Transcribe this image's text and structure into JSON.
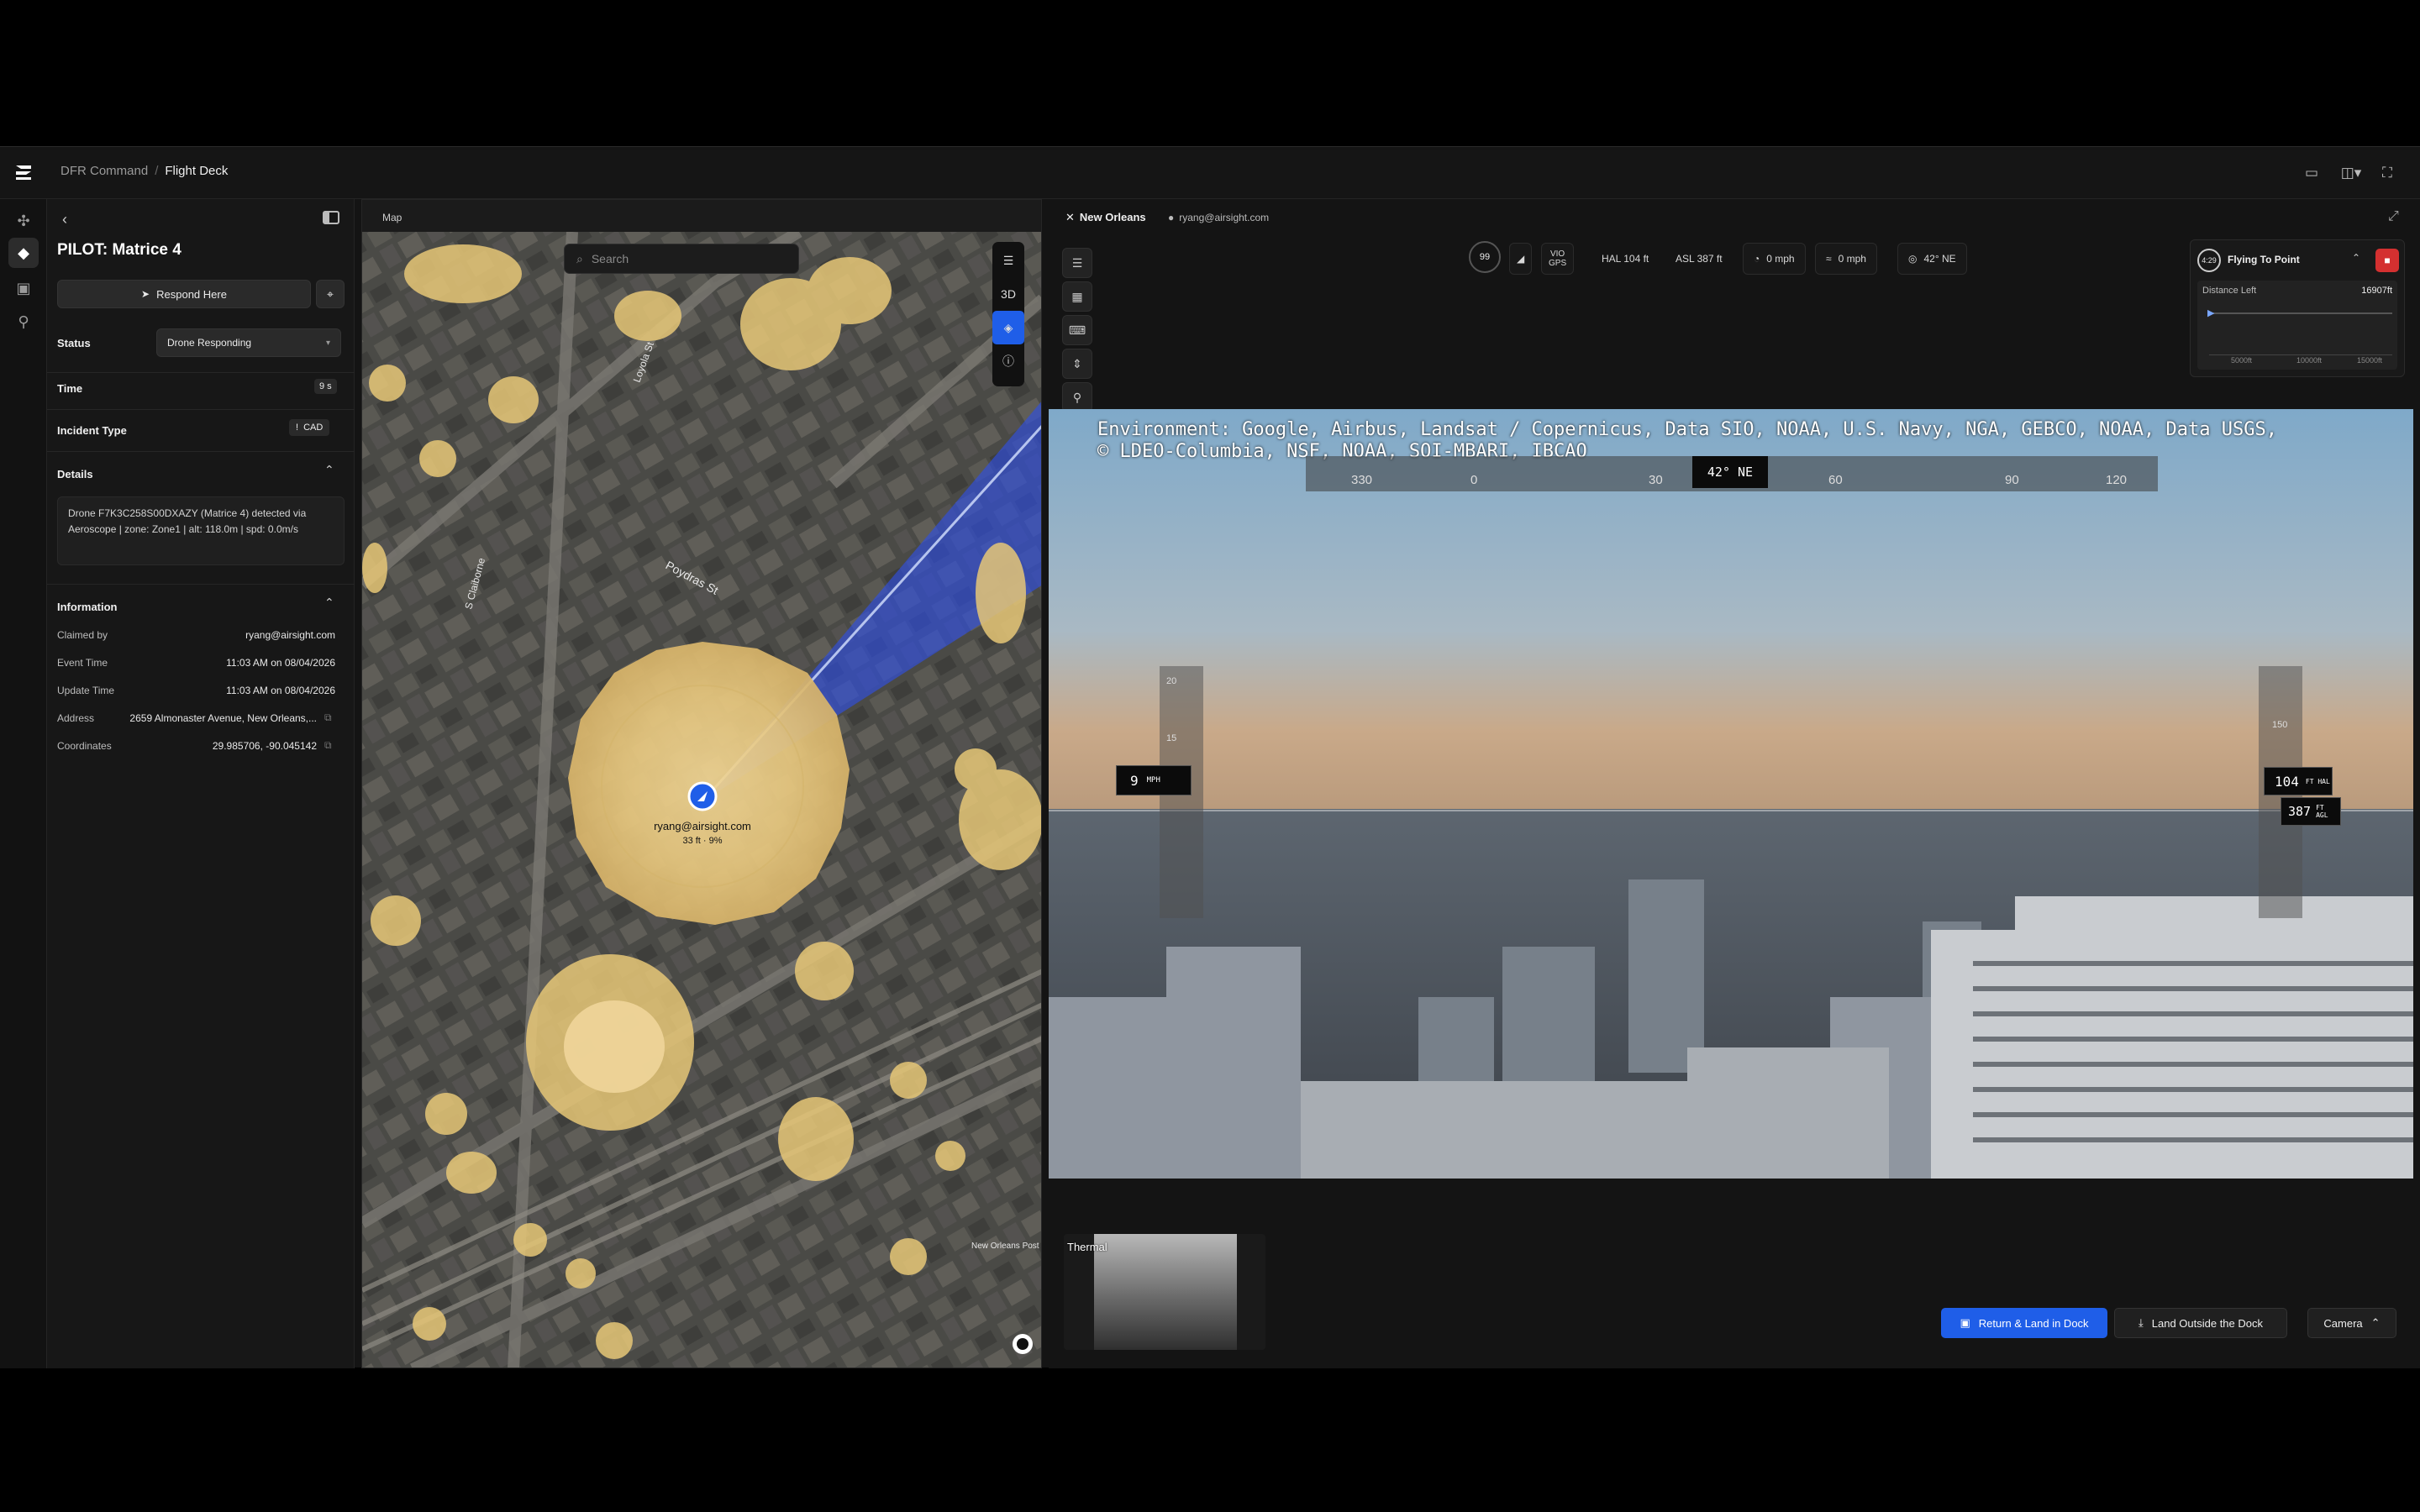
{
  "breadcrumb": {
    "root": "DFR Command",
    "current": "Flight Deck"
  },
  "panel": {
    "title": "PILOT: Matrice 4",
    "respond_label": "Respond Here",
    "status_label": "Status",
    "status_value": "Drone Responding",
    "time_label": "Time",
    "time_value": "9 s",
    "incident_label": "Incident Type",
    "incident_value": "CAD",
    "details_label": "Details",
    "details_text": "Drone F7K3C258S00DXAZY (Matrice 4) detected via Aeroscope | zone: Zone1 | alt: 118.0m | spd: 0.0m/s",
    "information_label": "Information",
    "info": [
      {
        "label": "Claimed by",
        "value": "ryang@airsight.com"
      },
      {
        "label": "Event Time",
        "value": "11:03 AM on 08/04/2026"
      },
      {
        "label": "Update Time",
        "value": "11:03 AM on 08/04/2026"
      },
      {
        "label": "Address",
        "value": "2659 Almonaster Avenue, New Orleans,..."
      },
      {
        "label": "Coordinates",
        "value": "29.985706, -90.045142"
      }
    ]
  },
  "map": {
    "title": "Map",
    "search_placeholder": "Search",
    "ctrl_3d": "3D",
    "user_label": "ryang@airsight.com",
    "user_sub": "33 ft · 9%",
    "street_1": "Poydras St",
    "street_2": "Loyola St",
    "street_3": "S Claiborne",
    "place_1": "New Orleans Post Office"
  },
  "video": {
    "location": "New Orleans",
    "user": "ryang@airsight.com",
    "telemetry": {
      "battery": "99",
      "vio": "VIO",
      "gps": "GPS",
      "hal": "HAL 104 ft",
      "asl": "ASL 387 ft",
      "speed": "0 mph",
      "wind": "0 mph",
      "heading": "42° NE"
    },
    "mission": {
      "timer": "4:29",
      "status": "Flying To Point",
      "distance_label": "Distance Left",
      "distance_value": "16907ft",
      "ticks": [
        "5000ft",
        "10000ft",
        "15000ft"
      ]
    },
    "attribution_1": "Environment: Google, Airbus, Landsat / Copernicus, Data SIO, NOAA, U.S. Navy, NGA, GEBCO, NOAA, Data USGS,",
    "attribution_2": "© LDEO-Columbia, NSF, NOAA, SOI-MBARI, IBCAO",
    "compass_ticks": [
      "330",
      "0",
      "30",
      "60",
      "90",
      "120"
    ],
    "compass_heading": "42° NE",
    "speed_value": "9",
    "speed_unit": "MPH",
    "alt_hal": "104",
    "alt_hal_unit": "FT HAL",
    "alt_agl": "387",
    "alt_agl_unit": "FT AGL",
    "speed_scale": [
      "20",
      "15"
    ],
    "alt_scale": [
      "150"
    ],
    "thermal_label": "Thermal",
    "btn_return": "Return & Land in Dock",
    "btn_land": "Land Outside the Dock",
    "btn_camera": "Camera"
  }
}
